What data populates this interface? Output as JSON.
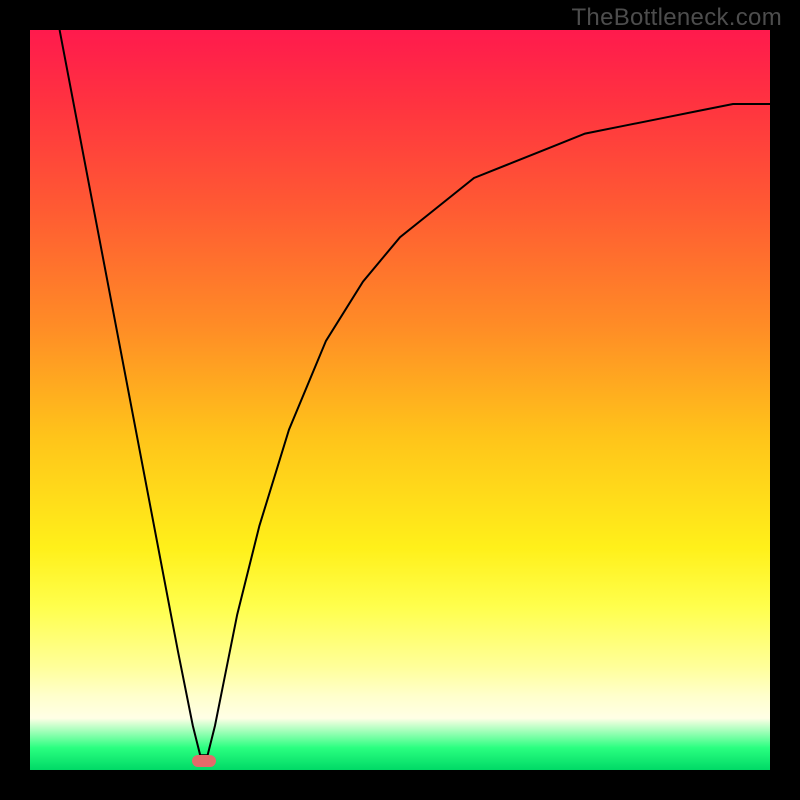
{
  "watermark": "TheBottleneck.com",
  "colors": {
    "frame": "#000000",
    "curve": "#000000",
    "marker": "#e36a6a",
    "gradient_stops": [
      {
        "pos": 0,
        "color": "#ff1a4d"
      },
      {
        "pos": 0.1,
        "color": "#ff3340"
      },
      {
        "pos": 0.24,
        "color": "#ff5a33"
      },
      {
        "pos": 0.4,
        "color": "#ff8c26"
      },
      {
        "pos": 0.55,
        "color": "#ffc41a"
      },
      {
        "pos": 0.7,
        "color": "#fff01a"
      },
      {
        "pos": 0.78,
        "color": "#ffff4d"
      },
      {
        "pos": 0.86,
        "color": "#ffff99"
      },
      {
        "pos": 0.9,
        "color": "#ffffcc"
      },
      {
        "pos": 0.93,
        "color": "#ffffe6"
      },
      {
        "pos": 0.97,
        "color": "#2aff80"
      },
      {
        "pos": 1.0,
        "color": "#00d966"
      }
    ]
  },
  "chart_data": {
    "type": "line",
    "title": "",
    "xlabel": "",
    "ylabel": "",
    "xlim": [
      0,
      100
    ],
    "ylim": [
      0,
      100
    ],
    "series": [
      {
        "name": "bottleneck-curve",
        "x": [
          4,
          8,
          12,
          16,
          20,
          22,
          23,
          24,
          25,
          26,
          28,
          31,
          35,
          40,
          45,
          50,
          55,
          60,
          65,
          70,
          75,
          80,
          85,
          90,
          95,
          100
        ],
        "y": [
          100,
          79,
          58,
          37,
          16,
          6,
          2,
          2,
          6,
          11,
          21,
          33,
          46,
          58,
          66,
          72,
          76,
          80,
          82,
          84,
          86,
          87,
          88,
          89,
          90,
          90
        ]
      }
    ],
    "marker": {
      "name": "optimal-point",
      "x": 23.5,
      "y": 1.2,
      "width_pct": 3.2,
      "height_pct": 1.6
    }
  }
}
